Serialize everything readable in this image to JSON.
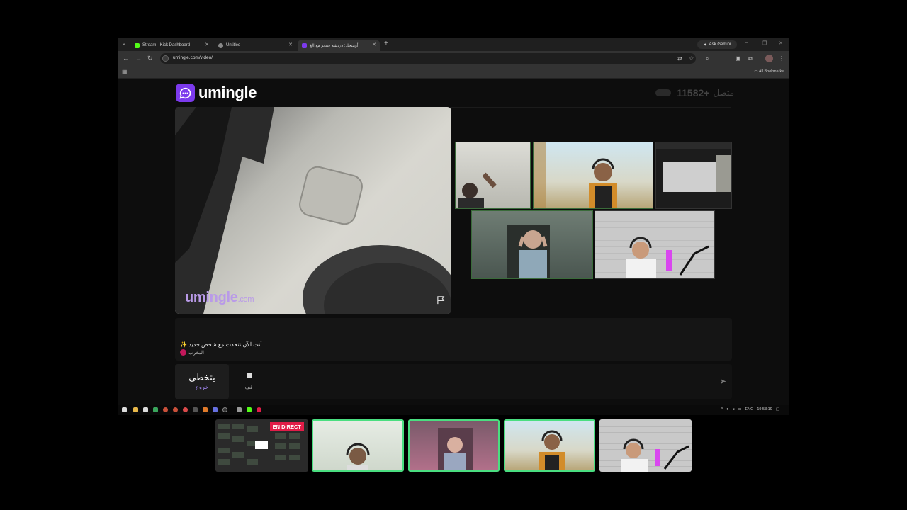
{
  "browser": {
    "tabs": [
      {
        "title": "Stream - Kick Dashboard",
        "icon": "kick-icon"
      },
      {
        "title": "Untitled",
        "icon": "globe-icon"
      },
      {
        "title": "أوميجل: دردشة فيديو مع الغ",
        "icon": "umingle-icon"
      }
    ],
    "ask_gemini": "Ask Gemini",
    "url": "umingle.com/video/",
    "all_bookmarks": "All Bookmarks"
  },
  "page": {
    "brand": "umingle",
    "online_count": "11582+",
    "online_label": "متصل",
    "watermark": "umingle",
    "watermark_suffix": ".com",
    "chat": {
      "system_message": "✨ أنت الآن تتحدث مع شخص جديد",
      "country": "المغرب"
    },
    "controls": {
      "skip_label": "يتخطى",
      "skip_sub": "خروج",
      "stop_label": "قف"
    }
  },
  "taskbar": {
    "lang": "ENG",
    "time": "19:53:19"
  },
  "stream": {
    "live_badge": "EN DIRECT"
  },
  "colors": {
    "brand_purple": "#7c3aed",
    "live_red": "#e11d48",
    "cam_border_green": "#4ade80"
  }
}
